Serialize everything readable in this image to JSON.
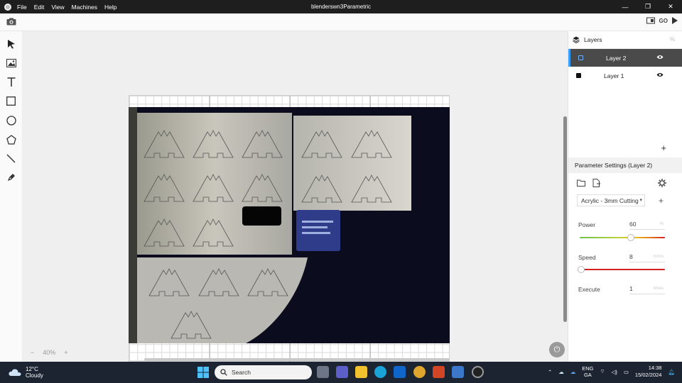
{
  "window": {
    "title": "blenderswn3Parametric"
  },
  "menu": [
    "File",
    "Edit",
    "View",
    "Machines",
    "Help"
  ],
  "toolbar": {
    "go_label": "GO"
  },
  "canvas": {
    "zoom_minus": "−",
    "zoom_level": "40%",
    "zoom_plus": "+"
  },
  "layers_panel": {
    "title": "Layers",
    "layers": [
      {
        "name": "Layer 2",
        "active": true
      },
      {
        "name": "Layer 1",
        "active": false
      }
    ],
    "add_label": "+"
  },
  "parameters": {
    "title": "Parameter Settings (Layer 2)",
    "material": "Acrylic - 3mm Cutting",
    "add_label": "+",
    "power": {
      "label": "Power",
      "value": "60",
      "unit": "%",
      "fraction": 0.6
    },
    "speed": {
      "label": "Speed",
      "value": "8",
      "unit": "mm/s",
      "fraction": 0.02
    },
    "execute": {
      "label": "Execute",
      "value": "1",
      "unit": "times"
    }
  },
  "taskbar": {
    "weather_temp": "12°C",
    "weather_desc": "Cloudy",
    "search_placeholder": "Search",
    "lang_top": "ENG",
    "lang_bottom": "GA",
    "time": "14:38",
    "date": "15/02/2024"
  }
}
